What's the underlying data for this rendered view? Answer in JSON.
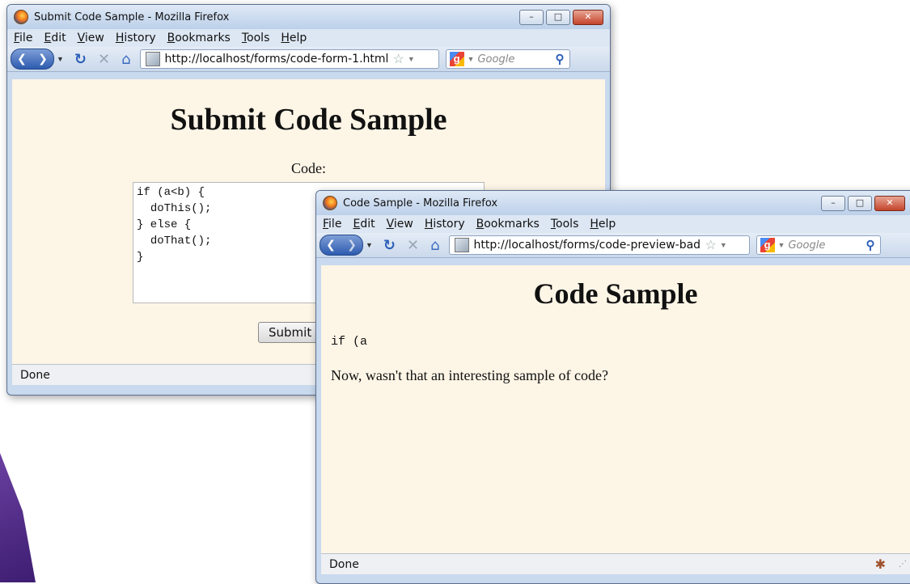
{
  "window1": {
    "title": "Submit Code Sample - Mozilla Firefox",
    "menu": [
      "File",
      "Edit",
      "View",
      "History",
      "Bookmarks",
      "Tools",
      "Help"
    ],
    "url": "http://localhost/forms/code-form-1.html",
    "search_placeholder": "Google",
    "heading": "Submit Code Sample",
    "code_label": "Code:",
    "code_value": "if (a<b) {\n  doThis();\n} else {\n  doThat();\n}",
    "submit_label": "Submit Code",
    "status": "Done"
  },
  "window2": {
    "title": "Code Sample - Mozilla Firefox",
    "menu": [
      "File",
      "Edit",
      "View",
      "History",
      "Bookmarks",
      "Tools",
      "Help"
    ],
    "url": "http://localhost/forms/code-preview-bad",
    "search_placeholder": "Google",
    "heading": "Code Sample",
    "code_sample": "if (a",
    "note": "Now, wasn't that an interesting sample of code?",
    "status": "Done"
  },
  "icons": {
    "back": "back-arrow-icon",
    "forward": "forward-arrow-icon",
    "reload": "reload-icon",
    "stop": "stop-icon",
    "home": "home-icon",
    "bookmark": "star-icon",
    "search": "magnifier-icon"
  }
}
